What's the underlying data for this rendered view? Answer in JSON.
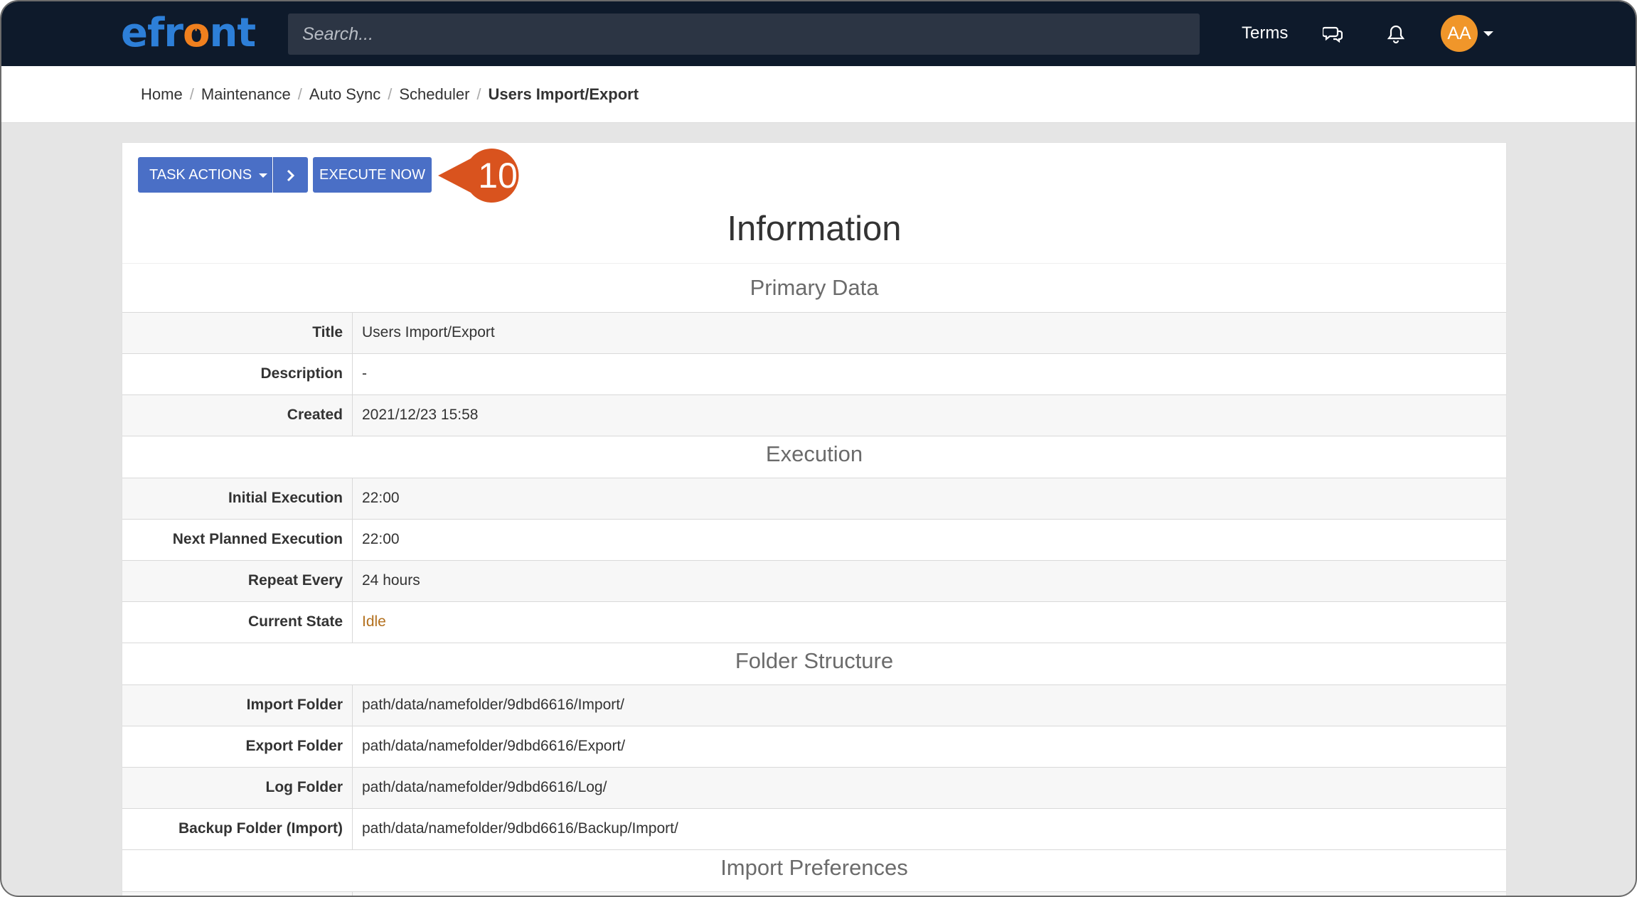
{
  "navbar": {
    "logo": "efront",
    "search_placeholder": "Search...",
    "terms_label": "Terms",
    "avatar_initials": "AA"
  },
  "breadcrumb": [
    "Home",
    "Maintenance",
    "Auto Sync",
    "Scheduler",
    "Users Import/Export"
  ],
  "actions": {
    "task_actions_label": "TASK ACTIONS",
    "execute_now_label": "EXECUTE NOW"
  },
  "callout": {
    "number": "10",
    "color": "#d9531e"
  },
  "main": {
    "title": "Information",
    "sections": [
      {
        "heading": "Primary Data",
        "rows": [
          {
            "label": "Title",
            "value": "Users Import/Export"
          },
          {
            "label": "Description",
            "value": "-"
          },
          {
            "label": "Created",
            "value": "2021/12/23 15:58"
          }
        ]
      },
      {
        "heading": "Execution",
        "rows": [
          {
            "label": "Initial Execution",
            "value": "22:00"
          },
          {
            "label": "Next Planned Execution",
            "value": "22:00"
          },
          {
            "label": "Repeat Every",
            "value": "24 hours"
          },
          {
            "label": "Current State",
            "value": "Idle"
          }
        ]
      },
      {
        "heading": "Folder Structure",
        "rows": [
          {
            "label": "Import Folder",
            "value": "path/data/namefolder/9dbd6616/Import/"
          },
          {
            "label": "Export Folder",
            "value": "path/data/namefolder/9dbd6616/Export/"
          },
          {
            "label": "Log Folder",
            "value": "path/data/namefolder/9dbd6616/Log/"
          },
          {
            "label": "Backup Folder (Import)",
            "value": "path/data/namefolder/9dbd6616/Backup/Import/"
          }
        ]
      },
      {
        "heading": "Import Preferences",
        "rows": []
      }
    ]
  },
  "colors": {
    "navbar": "#0e1a2b",
    "button": "#4a6fc6",
    "state_idle": "#b3701e",
    "avatar": "#f0962a"
  }
}
